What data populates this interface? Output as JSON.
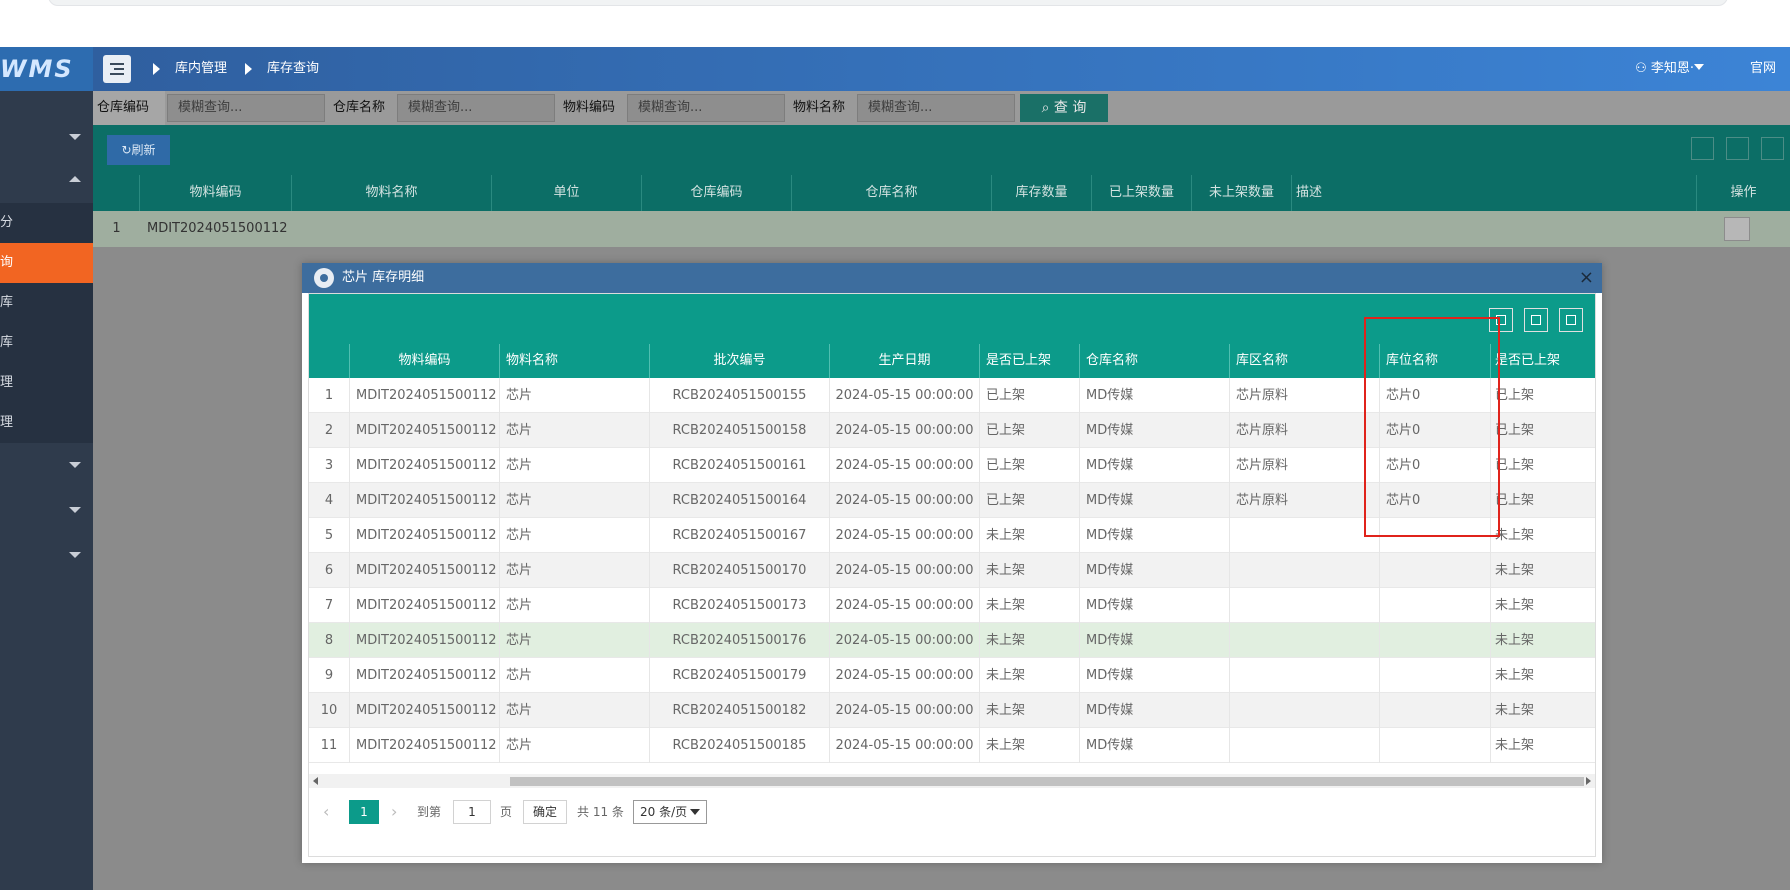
{
  "app": {
    "logo": "WMS"
  },
  "header": {
    "breadcrumb": [
      "库内管理",
      "库存查询"
    ],
    "user": "李知恩·",
    "home_link": "官网"
  },
  "sidebar": {
    "items": [
      {
        "label": ""
      },
      {
        "label": ""
      },
      {
        "label": "划分"
      },
      {
        "label": "查询"
      },
      {
        "label": "入库"
      },
      {
        "label": "出库"
      },
      {
        "label": "管理"
      },
      {
        "label": "管理"
      }
    ]
  },
  "search": {
    "fields": [
      {
        "label": "仓库编码",
        "placeholder": "模糊查询..."
      },
      {
        "label": "仓库名称",
        "placeholder": "模糊查询..."
      },
      {
        "label": "物料编码",
        "placeholder": "模糊查询..."
      },
      {
        "label": "物料名称",
        "placeholder": "模糊查询..."
      }
    ],
    "button": "查 询"
  },
  "toolbar": {
    "refresh": "刷新"
  },
  "grid": {
    "headers": [
      "物料编码",
      "物料名称",
      "单位",
      "仓库编码",
      "仓库名称",
      "库存数量",
      "已上架数量",
      "未上架数量",
      "描述",
      "操作"
    ],
    "row": {
      "index": "1",
      "code": "MDIT2024051500112"
    }
  },
  "modal": {
    "title": "芯片 库存明细",
    "close": "×",
    "headers": [
      "物料编码",
      "物料名称",
      "批次编号",
      "生产日期",
      "是否已上架",
      "仓库名称",
      "库区名称",
      "库位名称",
      "是否已上架"
    ],
    "rows": [
      [
        "1",
        "MDIT2024051500112",
        "芯片",
        "RCB2024051500155",
        "2024-05-15 00:00:00",
        "已上架",
        "MD传媒",
        "芯片原料",
        "芯片0",
        "已上架"
      ],
      [
        "2",
        "MDIT2024051500112",
        "芯片",
        "RCB2024051500158",
        "2024-05-15 00:00:00",
        "已上架",
        "MD传媒",
        "芯片原料",
        "芯片0",
        "已上架"
      ],
      [
        "3",
        "MDIT2024051500112",
        "芯片",
        "RCB2024051500161",
        "2024-05-15 00:00:00",
        "已上架",
        "MD传媒",
        "芯片原料",
        "芯片0",
        "已上架"
      ],
      [
        "4",
        "MDIT2024051500112",
        "芯片",
        "RCB2024051500164",
        "2024-05-15 00:00:00",
        "已上架",
        "MD传媒",
        "芯片原料",
        "芯片0",
        "已上架"
      ],
      [
        "5",
        "MDIT2024051500112",
        "芯片",
        "RCB2024051500167",
        "2024-05-15 00:00:00",
        "未上架",
        "MD传媒",
        "",
        "",
        "未上架"
      ],
      [
        "6",
        "MDIT2024051500112",
        "芯片",
        "RCB2024051500170",
        "2024-05-15 00:00:00",
        "未上架",
        "MD传媒",
        "",
        "",
        "未上架"
      ],
      [
        "7",
        "MDIT2024051500112",
        "芯片",
        "RCB2024051500173",
        "2024-05-15 00:00:00",
        "未上架",
        "MD传媒",
        "",
        "",
        "未上架"
      ],
      [
        "8",
        "MDIT2024051500112",
        "芯片",
        "RCB2024051500176",
        "2024-05-15 00:00:00",
        "未上架",
        "MD传媒",
        "",
        "",
        "未上架"
      ],
      [
        "9",
        "MDIT2024051500112",
        "芯片",
        "RCB2024051500179",
        "2024-05-15 00:00:00",
        "未上架",
        "MD传媒",
        "",
        "",
        "未上架"
      ],
      [
        "10",
        "MDIT2024051500112",
        "芯片",
        "RCB2024051500182",
        "2024-05-15 00:00:00",
        "未上架",
        "MD传媒",
        "",
        "",
        "未上架"
      ],
      [
        "11",
        "MDIT2024051500112",
        "芯片",
        "RCB2024051500185",
        "2024-05-15 00:00:00",
        "未上架",
        "MD传媒",
        "",
        "",
        "未上架"
      ]
    ],
    "highlighted_row": 8,
    "pager": {
      "current_page": "1",
      "goto_label": "到第",
      "goto_value": "1",
      "page_unit": "页",
      "confirm": "确定",
      "total": "共 11 条",
      "page_size": "20 条/页"
    }
  },
  "colors": {
    "header": "#3c84d6",
    "teal": "#0c9b8a",
    "active_nav": "#f26522",
    "annotation": "#e0231b"
  }
}
